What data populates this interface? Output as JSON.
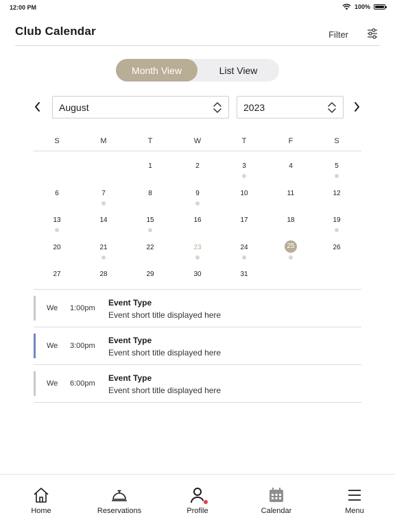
{
  "status_bar": {
    "time": "12:00 PM",
    "battery": "100%"
  },
  "header": {
    "title": "Club Calendar",
    "filter_label": "Filter"
  },
  "view_toggle": {
    "month_label": "Month View",
    "list_label": "List View",
    "active": "month"
  },
  "month_selector": {
    "month": "August",
    "year": "2023"
  },
  "calendar": {
    "weekdays": [
      "S",
      "M",
      "T",
      "W",
      "T",
      "F",
      "S"
    ],
    "days": [
      {
        "label": "1",
        "row": 0,
        "col": 2,
        "dot": false,
        "state": ""
      },
      {
        "label": "2",
        "row": 0,
        "col": 3,
        "dot": false,
        "state": ""
      },
      {
        "label": "3",
        "row": 0,
        "col": 4,
        "dot": true,
        "state": ""
      },
      {
        "label": "4",
        "row": 0,
        "col": 5,
        "dot": false,
        "state": ""
      },
      {
        "label": "5",
        "row": 0,
        "col": 6,
        "dot": true,
        "state": ""
      },
      {
        "label": "6",
        "row": 1,
        "col": 0,
        "dot": false,
        "state": ""
      },
      {
        "label": "7",
        "row": 1,
        "col": 1,
        "dot": true,
        "state": ""
      },
      {
        "label": "8",
        "row": 1,
        "col": 2,
        "dot": false,
        "state": ""
      },
      {
        "label": "9",
        "row": 1,
        "col": 3,
        "dot": true,
        "state": ""
      },
      {
        "label": "10",
        "row": 1,
        "col": 4,
        "dot": false,
        "state": ""
      },
      {
        "label": "11",
        "row": 1,
        "col": 5,
        "dot": false,
        "state": ""
      },
      {
        "label": "12",
        "row": 1,
        "col": 6,
        "dot": false,
        "state": ""
      },
      {
        "label": "13",
        "row": 2,
        "col": 0,
        "dot": true,
        "state": ""
      },
      {
        "label": "14",
        "row": 2,
        "col": 1,
        "dot": false,
        "state": ""
      },
      {
        "label": "15",
        "row": 2,
        "col": 2,
        "dot": true,
        "state": ""
      },
      {
        "label": "16",
        "row": 2,
        "col": 3,
        "dot": false,
        "state": ""
      },
      {
        "label": "17",
        "row": 2,
        "col": 4,
        "dot": false,
        "state": ""
      },
      {
        "label": "18",
        "row": 2,
        "col": 5,
        "dot": false,
        "state": ""
      },
      {
        "label": "19",
        "row": 2,
        "col": 6,
        "dot": true,
        "state": ""
      },
      {
        "label": "20",
        "row": 3,
        "col": 0,
        "dot": false,
        "state": ""
      },
      {
        "label": "21",
        "row": 3,
        "col": 1,
        "dot": true,
        "state": ""
      },
      {
        "label": "22",
        "row": 3,
        "col": 2,
        "dot": false,
        "state": ""
      },
      {
        "label": "23",
        "row": 3,
        "col": 3,
        "dot": true,
        "state": "today"
      },
      {
        "label": "24",
        "row": 3,
        "col": 4,
        "dot": true,
        "state": ""
      },
      {
        "label": "25",
        "row": 3,
        "col": 5,
        "dot": true,
        "state": "selected"
      },
      {
        "label": "26",
        "row": 3,
        "col": 6,
        "dot": false,
        "state": ""
      },
      {
        "label": "27",
        "row": 4,
        "col": 0,
        "dot": false,
        "state": ""
      },
      {
        "label": "28",
        "row": 4,
        "col": 1,
        "dot": false,
        "state": ""
      },
      {
        "label": "29",
        "row": 4,
        "col": 2,
        "dot": false,
        "state": ""
      },
      {
        "label": "30",
        "row": 4,
        "col": 3,
        "dot": false,
        "state": ""
      },
      {
        "label": "31",
        "row": 4,
        "col": 4,
        "dot": false,
        "state": ""
      }
    ]
  },
  "events": [
    {
      "day": "We",
      "time": "1:00pm",
      "type": "Event Type",
      "title": "Event short title displayed here",
      "active": false
    },
    {
      "day": "We",
      "time": "3:00pm",
      "type": "Event Type",
      "title": "Event short title displayed here",
      "active": true
    },
    {
      "day": "We",
      "time": "6:00pm",
      "type": "Event Type",
      "title": "Event short title displayed here",
      "active": false
    }
  ],
  "tab_bar": {
    "home": "Home",
    "reservations": "Reservations",
    "profile": "Profile",
    "calendar": "Calendar",
    "menu": "Menu"
  },
  "colors": {
    "accent": "#b8ad95",
    "event_active": "#6f88bd",
    "event_dot": "#d6d6d6",
    "notification": "#e0444a",
    "calendar_tab_icon": "#8e8e93"
  }
}
